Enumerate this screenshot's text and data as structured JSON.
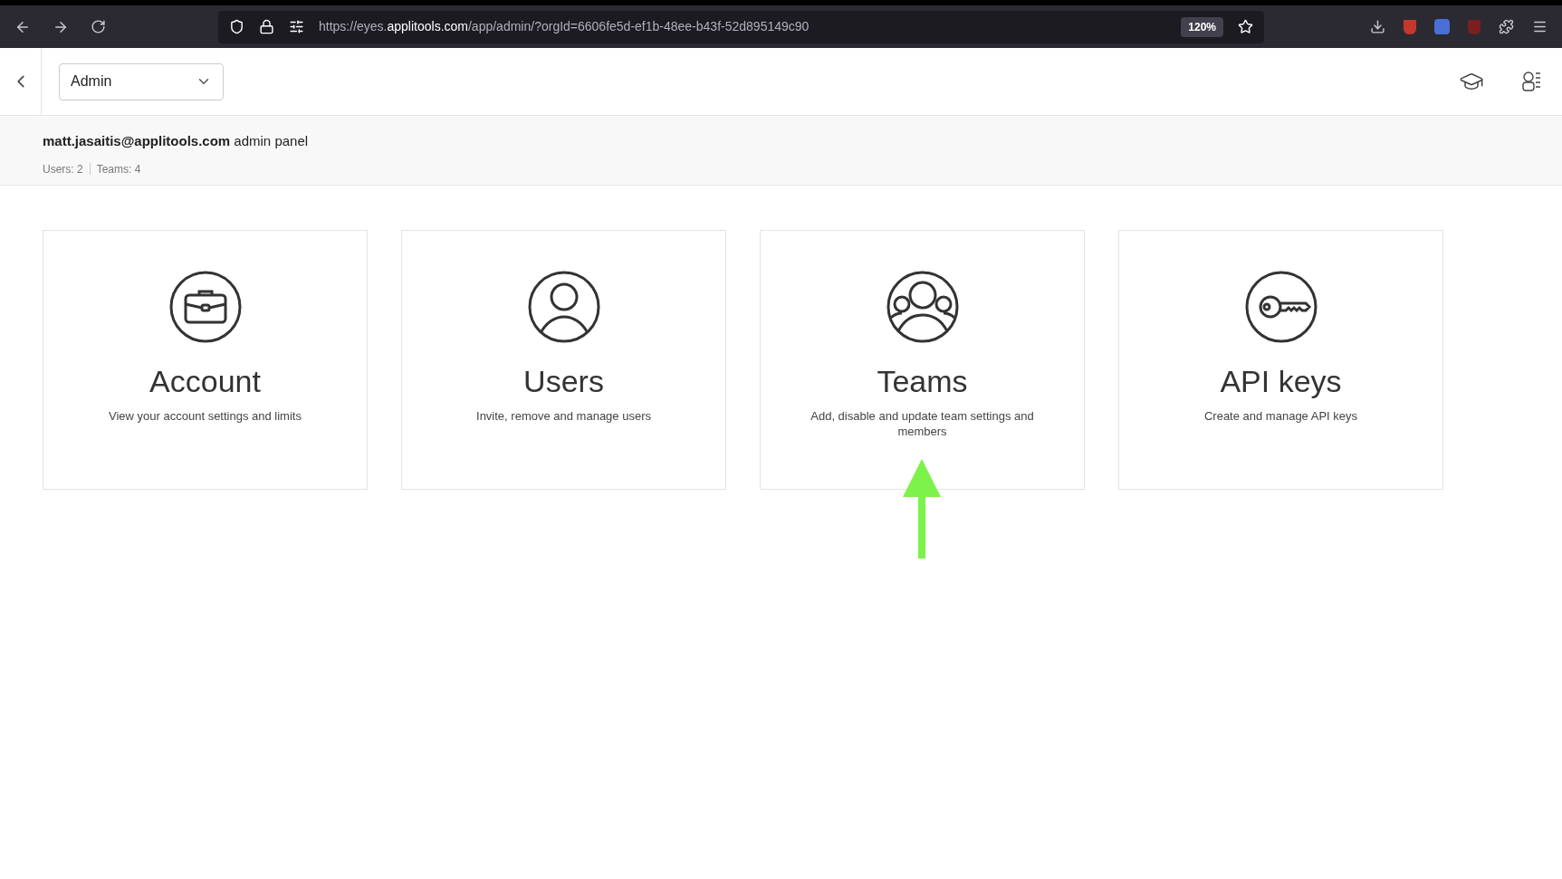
{
  "browser": {
    "url": {
      "scheme": "https://eyes.",
      "domain": "applitools.com",
      "path": "/app/admin/?orgId=6606fe5d-ef1b-48ee-b43f-52d895149c90"
    },
    "zoom": "120%"
  },
  "header": {
    "selector": "Admin"
  },
  "info": {
    "email": "matt.jasaitis@applitools.com",
    "suffix": "admin panel",
    "stats": [
      "Users: 2",
      "Teams: 4"
    ]
  },
  "cards": [
    {
      "kind": "briefcase",
      "title": "Account",
      "description": "View your account settings and limits",
      "arrow_pointer": false
    },
    {
      "kind": "person",
      "title": "Users",
      "description": "Invite, remove and manage users",
      "arrow_pointer": false
    },
    {
      "kind": "group",
      "title": "Teams",
      "description": "Add, disable and update team settings and members",
      "arrow_pointer": true
    },
    {
      "kind": "key",
      "title": "API keys",
      "description": "Create and manage API keys",
      "arrow_pointer": false
    }
  ]
}
